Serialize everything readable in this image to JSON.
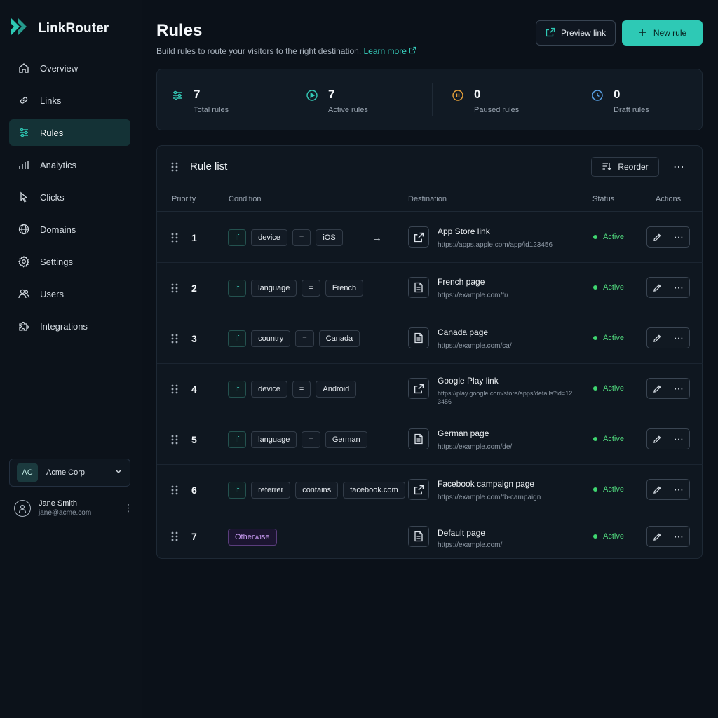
{
  "app": {
    "name": "LinkRouter"
  },
  "sidebar": {
    "items": [
      {
        "label": "Overview",
        "icon": "home-icon"
      },
      {
        "label": "Links",
        "icon": "link-icon"
      },
      {
        "label": "Rules",
        "icon": "rules-icon",
        "active": true
      },
      {
        "label": "Analytics",
        "icon": "bar-chart-icon"
      },
      {
        "label": "Clicks",
        "icon": "cursor-icon"
      },
      {
        "label": "Domains",
        "icon": "globe-icon"
      },
      {
        "label": "Settings",
        "icon": "gear-icon"
      },
      {
        "label": "Users",
        "icon": "users-icon"
      },
      {
        "label": "Integrations",
        "icon": "puzzle-icon"
      }
    ],
    "org": {
      "initials": "AC",
      "name": "Acme Corp"
    },
    "user": {
      "name": "Jane Smith",
      "email": "jane@acme.com"
    }
  },
  "header": {
    "title": "Rules",
    "subtitle": "Build rules to route your visitors to the right destination.",
    "learn_more": "Learn more",
    "preview_label": "Preview link",
    "new_rule_label": "New rule"
  },
  "stats": [
    {
      "value": "7",
      "label": "Total rules",
      "icon": "sliders-icon",
      "color": "#34c9b6"
    },
    {
      "value": "7",
      "label": "Active rules",
      "icon": "play-circle-icon",
      "color": "#34c9b6"
    },
    {
      "value": "0",
      "label": "Paused rules",
      "icon": "pause-circle-icon",
      "color": "#e8a23a"
    },
    {
      "value": "0",
      "label": "Draft rules",
      "icon": "clock-icon",
      "color": "#5aa3e8"
    }
  ],
  "rule_list": {
    "title": "Rule list",
    "reorder_label": "Reorder",
    "columns": {
      "priority": "Priority",
      "condition": "Condition",
      "destination": "Destination",
      "status": "Status",
      "actions": "Actions"
    },
    "rows": [
      {
        "priority": "1",
        "condition": [
          "If",
          "device",
          "=",
          "iOS"
        ],
        "arrow": "→",
        "dest_icon": "external-link-icon",
        "dest_name": "App Store link",
        "dest_url": "https://apps.apple.com/app/id123456",
        "status": "Active"
      },
      {
        "priority": "2",
        "condition": [
          "If",
          "language",
          "=",
          "French"
        ],
        "dest_icon": "document-icon",
        "dest_name": "French page",
        "dest_url": "https://example.com/fr/",
        "status": "Active"
      },
      {
        "priority": "3",
        "condition": [
          "If",
          "country",
          "=",
          "Canada"
        ],
        "dest_icon": "document-icon",
        "dest_name": "Canada page",
        "dest_url": "https://example.com/ca/",
        "status": "Active"
      },
      {
        "priority": "4",
        "condition": [
          "If",
          "device",
          "=",
          "Android"
        ],
        "dest_icon": "external-link-icon",
        "dest_name": "Google Play link",
        "dest_url": "https://play.google.com/store/apps/details?id=123456",
        "status": "Active"
      },
      {
        "priority": "5",
        "condition": [
          "If",
          "language",
          "=",
          "German"
        ],
        "dest_icon": "document-icon",
        "dest_name": "German page",
        "dest_url": "https://example.com/de/",
        "status": "Active"
      },
      {
        "priority": "6",
        "condition": [
          "If",
          "referrer",
          "contains",
          "facebook.com"
        ],
        "dest_icon": "external-link-icon",
        "dest_name": "Facebook campaign page",
        "dest_url": "https://example.com/fb-campaign",
        "status": "Active"
      },
      {
        "priority": "7",
        "condition": [
          "Otherwise"
        ],
        "dest_icon": "document-icon",
        "dest_name": "Default page",
        "dest_url": "https://example.com/",
        "status": "Active"
      }
    ]
  },
  "colors": {
    "accent": "#2ec9b5",
    "active_status": "#4fd67c",
    "otherwise_chip": "#c99bf2"
  }
}
